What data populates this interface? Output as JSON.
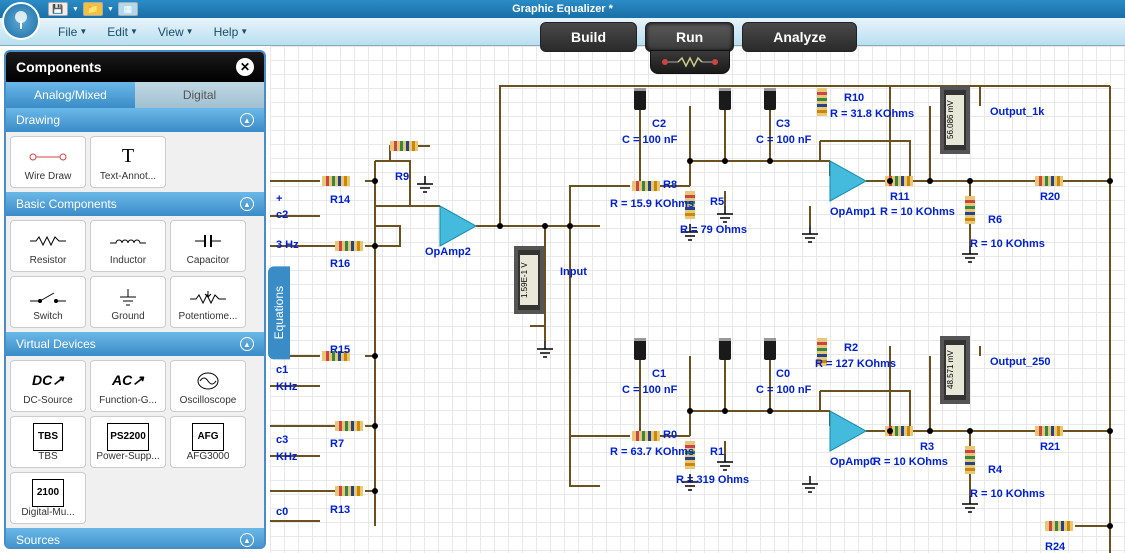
{
  "app": {
    "title": "Graphic Equalizer *"
  },
  "menubar": {
    "file": "File",
    "edit": "Edit",
    "view": "View",
    "help": "Help"
  },
  "mode_tabs": {
    "build": "Build",
    "run": "Run",
    "analyze": "Analyze",
    "active": "Run"
  },
  "components_panel": {
    "title": "Components",
    "tabs": {
      "analog": "Analog/Mixed",
      "digital": "Digital",
      "active": "analog"
    },
    "sections": {
      "drawing": {
        "title": "Drawing",
        "items": [
          {
            "label": "Wire Draw",
            "icon": "wire-draw"
          },
          {
            "label": "Text-Annot...",
            "icon": "text"
          }
        ]
      },
      "basic": {
        "title": "Basic Components",
        "items": [
          {
            "label": "Resistor",
            "icon": "resistor"
          },
          {
            "label": "Inductor",
            "icon": "inductor"
          },
          {
            "label": "Capacitor",
            "icon": "capacitor"
          },
          {
            "label": "Switch",
            "icon": "switch"
          },
          {
            "label": "Ground",
            "icon": "ground"
          },
          {
            "label": "Potentiome...",
            "icon": "potentiometer"
          }
        ]
      },
      "virtual": {
        "title": "Virtual Devices",
        "items": [
          {
            "label": "DC-Source",
            "icon": "dc"
          },
          {
            "label": "Function-G...",
            "icon": "ac"
          },
          {
            "label": "Oscilloscope",
            "icon": "scope"
          },
          {
            "label": "TBS",
            "icon": "tbs"
          },
          {
            "label": "Power-Supp...",
            "icon": "ps2200"
          },
          {
            "label": "AFG3000",
            "icon": "afg"
          },
          {
            "label": "Digital-Mu...",
            "icon": "2100"
          }
        ]
      },
      "sources": {
        "title": "Sources"
      }
    }
  },
  "equations_tab": "Equations",
  "circuit": {
    "labels": {
      "c2": "c2",
      "hz3": "3 Hz",
      "c1": "c1",
      "khz1": "KHz",
      "c3": "c3",
      "khz2": "KHz",
      "c0": "c0",
      "R14": "R14",
      "R9": "R9",
      "R16": "R16",
      "R15": "R15",
      "R7": "R7",
      "R13": "R13",
      "OpAmp2": "OpAmp2",
      "Input": "Input",
      "C2": "C2",
      "C2v": "C = 100 nF",
      "R8": "R8",
      "R8v": "R = 15.9 KOhms",
      "R5": "R5",
      "R5v": "R = 79 Ohms",
      "C3": "C3",
      "C3v": "C = 100 nF",
      "R10": "R10",
      "R10v": "R = 31.8 KOhms",
      "OpAmp1": "OpAmp1",
      "R11": "R11",
      "R11v": "R = 10 KOhms",
      "Output_1k": "Output_1k",
      "m1": "56.086 mV",
      "R6": "R6",
      "R6v": "R = 10 KOhms",
      "R20": "R20",
      "C1": "C1",
      "C1v": "C = 100 nF",
      "R0": "R0",
      "R0v": "R = 63.7 KOhms",
      "R1": "R1",
      "R1v": "R = 319 Ohms",
      "C0": "C0",
      "C0v": "C = 100 nF",
      "R2": "R2",
      "R2v": "R = 127 KOhms",
      "OpAmp0": "OpAmp0",
      "R3": "R3",
      "R3v": "R = 10 KOhms",
      "Output_250": "Output_250",
      "m2": "48.571 mV",
      "R4": "R4",
      "R4v": "R = 10 KOhms",
      "R21": "R21",
      "R24": "R24",
      "m_in": "1.59E-1 V"
    }
  }
}
